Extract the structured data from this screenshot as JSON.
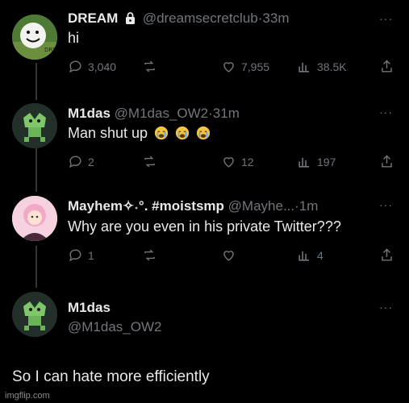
{
  "tweets": [
    {
      "name": "DREAM",
      "lock_icon": "lock-icon",
      "handle": "@dreamsecretclub",
      "sep": "·",
      "time": "33m",
      "text": "hi",
      "avatar_label": "DREAM",
      "replies": "3,040",
      "retweets": "",
      "likes": "7,955",
      "views": "38.5K"
    },
    {
      "name": "M1das",
      "handle": "@M1das_OW2",
      "sep": "·",
      "time": "31m",
      "text": "Man shut up",
      "replies": "2",
      "retweets": "",
      "likes": "12",
      "views": "197"
    },
    {
      "name": "Mayhem✧˖°. #moistsmp",
      "handle": "@Mayhe...",
      "sep": "·",
      "time": "1m",
      "text": "Why are you even in his private Twitter???",
      "replies": "1",
      "retweets": "",
      "likes": "",
      "views": "4"
    }
  ],
  "main_tweet": {
    "name": "M1das",
    "handle": "@M1das_OW2",
    "text": "So I can hate more efficiently"
  },
  "more_label": "···",
  "watermark": "imgflip.com",
  "colors": {
    "background": "#000000",
    "text": "#e7e9ea",
    "muted": "#71767b",
    "thread_line": "#333639",
    "emoji": "#f4c542"
  },
  "icons": [
    "reply-icon",
    "retweet-icon",
    "like-icon",
    "views-icon",
    "share-icon",
    "lock-icon",
    "more-icon"
  ]
}
